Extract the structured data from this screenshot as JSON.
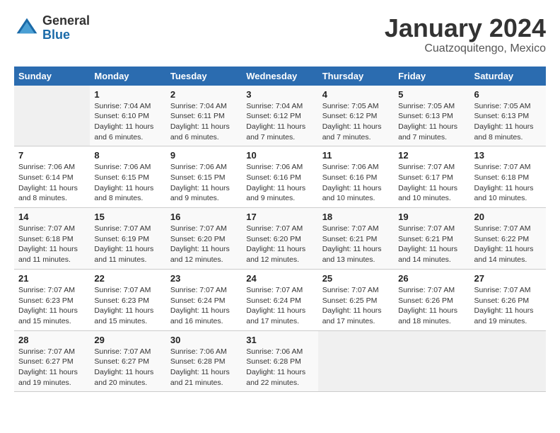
{
  "header": {
    "logo_general": "General",
    "logo_blue": "Blue",
    "month_title": "January 2024",
    "location": "Cuatzoquitengo, Mexico"
  },
  "days_of_week": [
    "Sunday",
    "Monday",
    "Tuesday",
    "Wednesday",
    "Thursday",
    "Friday",
    "Saturday"
  ],
  "weeks": [
    [
      null,
      {
        "day": "1",
        "sunrise": "7:04 AM",
        "sunset": "6:10 PM",
        "daylight": "11 hours and 6 minutes."
      },
      {
        "day": "2",
        "sunrise": "7:04 AM",
        "sunset": "6:11 PM",
        "daylight": "11 hours and 6 minutes."
      },
      {
        "day": "3",
        "sunrise": "7:04 AM",
        "sunset": "6:12 PM",
        "daylight": "11 hours and 7 minutes."
      },
      {
        "day": "4",
        "sunrise": "7:05 AM",
        "sunset": "6:12 PM",
        "daylight": "11 hours and 7 minutes."
      },
      {
        "day": "5",
        "sunrise": "7:05 AM",
        "sunset": "6:13 PM",
        "daylight": "11 hours and 7 minutes."
      },
      {
        "day": "6",
        "sunrise": "7:05 AM",
        "sunset": "6:13 PM",
        "daylight": "11 hours and 8 minutes."
      }
    ],
    [
      {
        "day": "7",
        "sunrise": "7:06 AM",
        "sunset": "6:14 PM",
        "daylight": "11 hours and 8 minutes."
      },
      {
        "day": "8",
        "sunrise": "7:06 AM",
        "sunset": "6:15 PM",
        "daylight": "11 hours and 8 minutes."
      },
      {
        "day": "9",
        "sunrise": "7:06 AM",
        "sunset": "6:15 PM",
        "daylight": "11 hours and 9 minutes."
      },
      {
        "day": "10",
        "sunrise": "7:06 AM",
        "sunset": "6:16 PM",
        "daylight": "11 hours and 9 minutes."
      },
      {
        "day": "11",
        "sunrise": "7:06 AM",
        "sunset": "6:16 PM",
        "daylight": "11 hours and 10 minutes."
      },
      {
        "day": "12",
        "sunrise": "7:07 AM",
        "sunset": "6:17 PM",
        "daylight": "11 hours and 10 minutes."
      },
      {
        "day": "13",
        "sunrise": "7:07 AM",
        "sunset": "6:18 PM",
        "daylight": "11 hours and 10 minutes."
      }
    ],
    [
      {
        "day": "14",
        "sunrise": "7:07 AM",
        "sunset": "6:18 PM",
        "daylight": "11 hours and 11 minutes."
      },
      {
        "day": "15",
        "sunrise": "7:07 AM",
        "sunset": "6:19 PM",
        "daylight": "11 hours and 11 minutes."
      },
      {
        "day": "16",
        "sunrise": "7:07 AM",
        "sunset": "6:20 PM",
        "daylight": "11 hours and 12 minutes."
      },
      {
        "day": "17",
        "sunrise": "7:07 AM",
        "sunset": "6:20 PM",
        "daylight": "11 hours and 12 minutes."
      },
      {
        "day": "18",
        "sunrise": "7:07 AM",
        "sunset": "6:21 PM",
        "daylight": "11 hours and 13 minutes."
      },
      {
        "day": "19",
        "sunrise": "7:07 AM",
        "sunset": "6:21 PM",
        "daylight": "11 hours and 14 minutes."
      },
      {
        "day": "20",
        "sunrise": "7:07 AM",
        "sunset": "6:22 PM",
        "daylight": "11 hours and 14 minutes."
      }
    ],
    [
      {
        "day": "21",
        "sunrise": "7:07 AM",
        "sunset": "6:23 PM",
        "daylight": "11 hours and 15 minutes."
      },
      {
        "day": "22",
        "sunrise": "7:07 AM",
        "sunset": "6:23 PM",
        "daylight": "11 hours and 15 minutes."
      },
      {
        "day": "23",
        "sunrise": "7:07 AM",
        "sunset": "6:24 PM",
        "daylight": "11 hours and 16 minutes."
      },
      {
        "day": "24",
        "sunrise": "7:07 AM",
        "sunset": "6:24 PM",
        "daylight": "11 hours and 17 minutes."
      },
      {
        "day": "25",
        "sunrise": "7:07 AM",
        "sunset": "6:25 PM",
        "daylight": "11 hours and 17 minutes."
      },
      {
        "day": "26",
        "sunrise": "7:07 AM",
        "sunset": "6:26 PM",
        "daylight": "11 hours and 18 minutes."
      },
      {
        "day": "27",
        "sunrise": "7:07 AM",
        "sunset": "6:26 PM",
        "daylight": "11 hours and 19 minutes."
      }
    ],
    [
      {
        "day": "28",
        "sunrise": "7:07 AM",
        "sunset": "6:27 PM",
        "daylight": "11 hours and 19 minutes."
      },
      {
        "day": "29",
        "sunrise": "7:07 AM",
        "sunset": "6:27 PM",
        "daylight": "11 hours and 20 minutes."
      },
      {
        "day": "30",
        "sunrise": "7:06 AM",
        "sunset": "6:28 PM",
        "daylight": "11 hours and 21 minutes."
      },
      {
        "day": "31",
        "sunrise": "7:06 AM",
        "sunset": "6:28 PM",
        "daylight": "11 hours and 22 minutes."
      },
      null,
      null,
      null
    ]
  ]
}
